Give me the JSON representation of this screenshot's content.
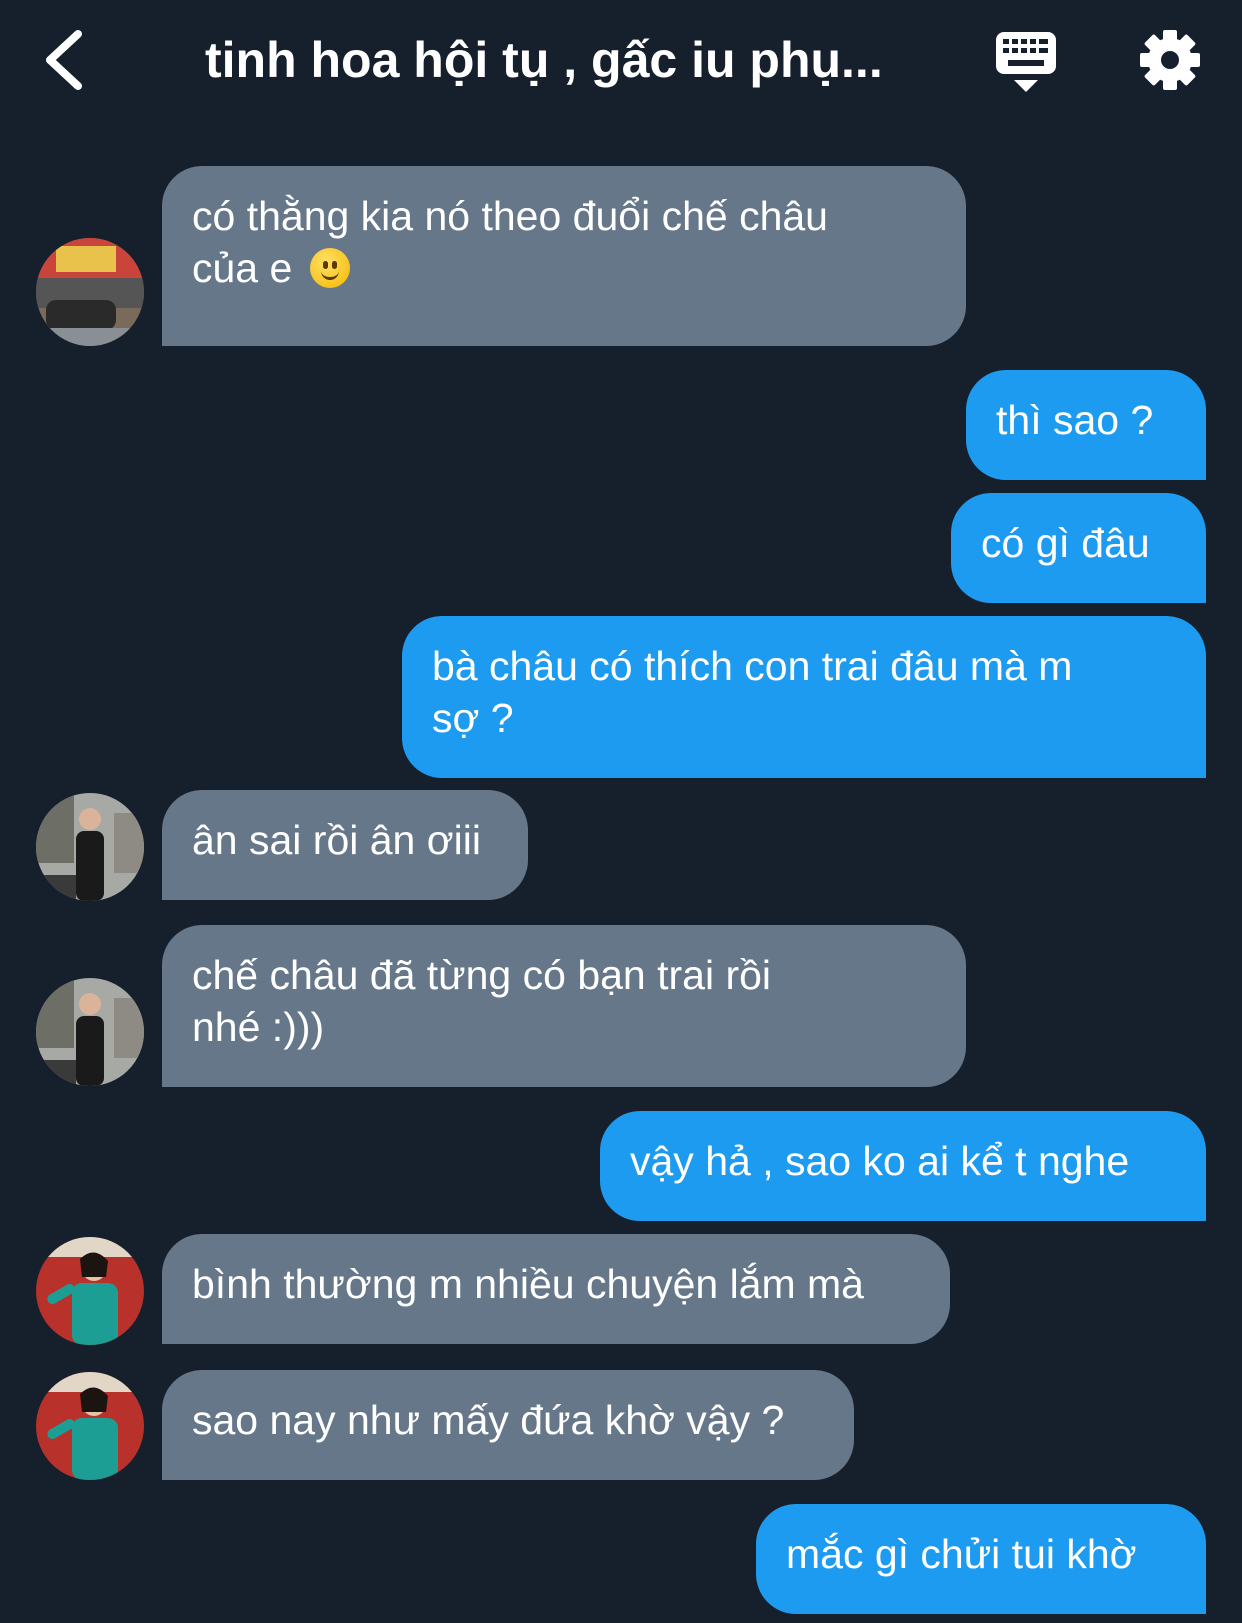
{
  "header": {
    "title": "tinh hoa hội tụ , gấc iu phụ...",
    "back_icon": "chevron-left-icon",
    "keyboard_icon": "keyboard-icon",
    "settings_icon": "gear-icon"
  },
  "colors": {
    "background": "#16202c",
    "incoming_bubble": "#66778a",
    "outgoing_bubble": "#1d9bf0",
    "text": "#ffffff"
  },
  "messages": [
    {
      "direction": "incoming",
      "avatar": "avatar-street",
      "lines": [
        "có thằng kia nó theo đuổi chế châu",
        "của e"
      ],
      "emoji": "slightly-smiling-face"
    },
    {
      "direction": "outgoing",
      "lines": [
        "thì sao ?"
      ]
    },
    {
      "direction": "outgoing",
      "lines": [
        "có gì đâu"
      ]
    },
    {
      "direction": "outgoing",
      "lines": [
        "bà châu có thích con trai đâu mà m",
        "sợ ?"
      ]
    },
    {
      "direction": "incoming",
      "avatar": "avatar-black-dress",
      "lines": [
        "ân sai rồi ân ơiii"
      ]
    },
    {
      "direction": "incoming",
      "avatar": "avatar-black-dress",
      "lines": [
        "chế châu đã từng có bạn trai rồi",
        "nhé :)))"
      ]
    },
    {
      "direction": "outgoing",
      "lines": [
        "vậy hả , sao ko ai kể t nghe"
      ]
    },
    {
      "direction": "incoming",
      "avatar": "avatar-teal-dress",
      "lines": [
        "bình thường m nhiều chuyện lắm mà"
      ]
    },
    {
      "direction": "incoming",
      "avatar": "avatar-teal-dress",
      "lines": [
        "sao nay như mấy đứa khờ vậy ?"
      ]
    },
    {
      "direction": "outgoing",
      "lines": [
        "mắc gì chửi tui khờ"
      ]
    }
  ]
}
